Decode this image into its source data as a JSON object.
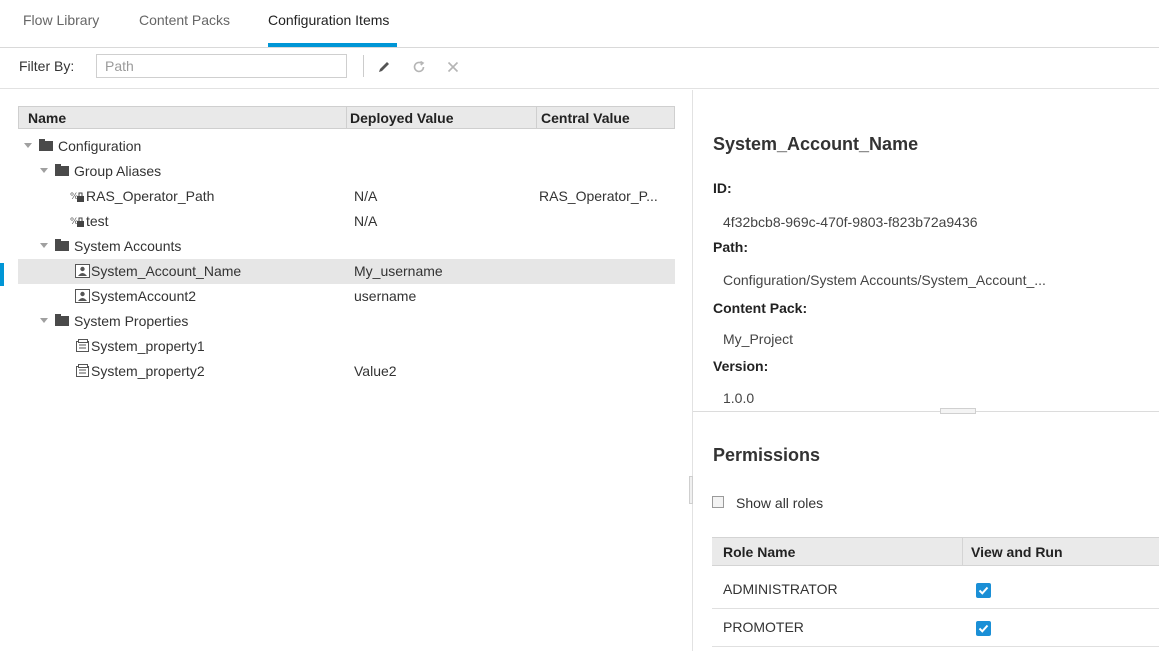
{
  "tabs": [
    "Flow Library",
    "Content Packs",
    "Configuration Items"
  ],
  "toolbar": {
    "filter_label": "Filter By:",
    "filter_placeholder": "Path",
    "icons": [
      "pencil-icon",
      "refresh-icon",
      "close-icon"
    ]
  },
  "tree": {
    "columns": [
      "Name",
      "Deployed Value",
      "Central Value"
    ],
    "rows": [
      {
        "name": "Configuration",
        "deployed": "",
        "central": "",
        "icon": "folder-icon"
      },
      {
        "name": "Group Aliases",
        "deployed": "",
        "central": "",
        "icon": "folder-icon"
      },
      {
        "name": "RAS_Operator_Path",
        "deployed": "N/A",
        "central": "RAS_Operator_P...",
        "icon": "group-alias-icon"
      },
      {
        "name": "test",
        "deployed": "N/A",
        "central": "",
        "icon": "group-alias-icon"
      },
      {
        "name": "System Accounts",
        "deployed": "",
        "central": "",
        "icon": "folder-icon"
      },
      {
        "name": "System_Account_Name",
        "deployed": "My_username",
        "central": "",
        "icon": "system-account-icon"
      },
      {
        "name": "SystemAccount2",
        "deployed": "username",
        "central": "",
        "icon": "system-account-icon"
      },
      {
        "name": "System Properties",
        "deployed": "",
        "central": "",
        "icon": "folder-icon"
      },
      {
        "name": "System_property1",
        "deployed": "",
        "central": "",
        "icon": "system-property-icon"
      },
      {
        "name": "System_property2",
        "deployed": "Value2",
        "central": "",
        "icon": "system-property-icon"
      }
    ]
  },
  "details": {
    "title": "System_Account_Name",
    "id_label": "ID:",
    "id_value": "4f32bcb8-969c-470f-9803-f823b72a9436",
    "path_label": "Path:",
    "path_value": "Configuration/System Accounts/System_Account_...",
    "content_pack_label": "Content Pack:",
    "content_pack_value": "My_Project",
    "version_label": "Version:",
    "version_value": "1.0.0"
  },
  "permissions": {
    "title": "Permissions",
    "show_all_roles": "Show all roles",
    "columns": [
      "Role Name",
      "View and Run"
    ],
    "rows": [
      {
        "role": "ADMINISTRATOR",
        "view_and_run": true
      },
      {
        "role": "PROMOTER",
        "view_and_run": true
      }
    ]
  },
  "colors": {
    "accent": "#0096d6",
    "checkbox": "#1a8fd6",
    "selected_row": "#e6e6e6"
  }
}
